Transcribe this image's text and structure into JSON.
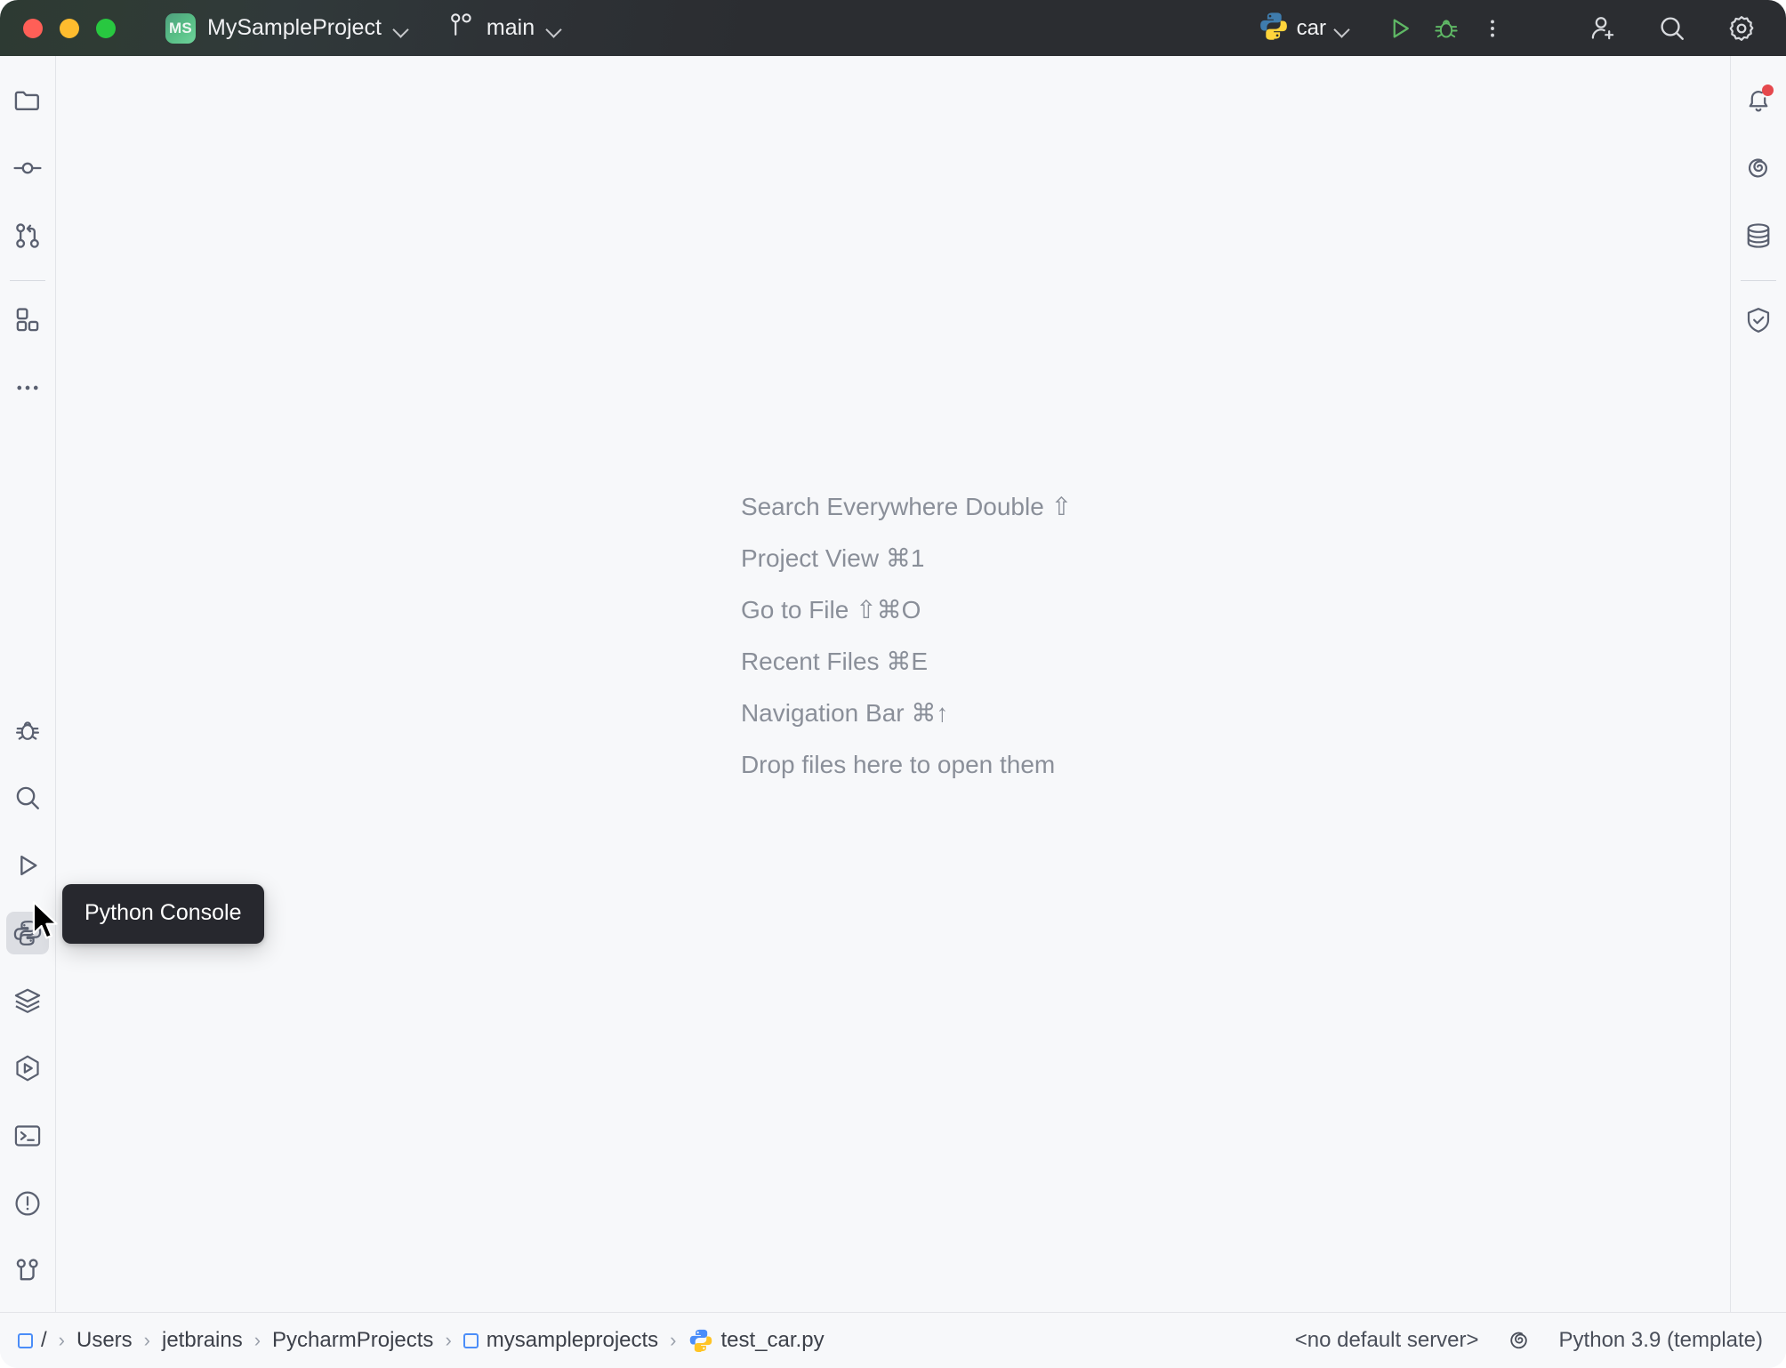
{
  "window": {
    "traffic_lights": [
      "close",
      "minimize",
      "maximize"
    ],
    "colors": {
      "close": "#ff5f57",
      "minimize": "#febc2e",
      "maximize": "#28c840",
      "accent_green": "#59a869",
      "notification_dot": "#e5484d",
      "python_blue": "#3f7cad",
      "python_yellow": "#ffd43b",
      "titlebar_bg": "#2b2d31",
      "app_bg": "#f7f8fa",
      "tooltip_bg": "#27282e"
    }
  },
  "titlebar": {
    "project_badge": "MS",
    "project_name": "MySampleProject",
    "project_chevron_icon": "chevron-down-icon",
    "vcs_branch_icon": "branch-icon",
    "branch_name": "main",
    "branch_chevron_icon": "chevron-down-icon",
    "run_config_icon": "python-icon",
    "run_config_name": "car",
    "run_config_chevron_icon": "chevron-down-icon",
    "run_button": "run-icon",
    "debug_button": "debug-icon",
    "more_button": "more-vertical-icon",
    "code_with_me": "add-user-icon",
    "search_button": "search-icon",
    "settings_button": "gear-icon"
  },
  "left_sidebar": {
    "top_items": [
      {
        "name": "project-tool-window",
        "icon": "folder-icon",
        "active": false
      },
      {
        "name": "commit-tool-window",
        "icon": "commit-icon",
        "active": false
      },
      {
        "name": "pull-requests-tool-window",
        "icon": "pull-request-icon",
        "active": false
      }
    ],
    "after_separator": [
      {
        "name": "structure-tool-window",
        "icon": "structure-icon",
        "active": false
      },
      {
        "name": "more-tool-windows",
        "icon": "more-horizontal-icon",
        "active": false
      }
    ],
    "bottom_items": [
      {
        "name": "debug-tool-window",
        "icon": "debug-bug-icon",
        "active": false
      },
      {
        "name": "find-tool-window",
        "icon": "search-icon",
        "active": false
      },
      {
        "name": "run-tool-window",
        "icon": "run-triangle-icon",
        "active": false
      },
      {
        "name": "python-console-tool-window",
        "icon": "python-icon",
        "active": true
      },
      {
        "name": "services-tool-window",
        "icon": "layers-icon",
        "active": false
      },
      {
        "name": "python-packages-tool-window",
        "icon": "hex-run-icon",
        "active": false
      },
      {
        "name": "terminal-tool-window",
        "icon": "terminal-icon",
        "active": false
      },
      {
        "name": "problems-tool-window",
        "icon": "warning-circle-icon",
        "active": false
      },
      {
        "name": "version-control-tool-window",
        "icon": "branch-icon",
        "active": false
      }
    ]
  },
  "right_sidebar": {
    "items": [
      {
        "name": "notifications-tool-window",
        "icon": "bell-icon",
        "badge": true
      },
      {
        "name": "ai-assistant-tool-window",
        "icon": "spiral-icon",
        "badge": false
      },
      {
        "name": "database-tool-window",
        "icon": "database-icon",
        "badge": false
      }
    ],
    "after_separator": [
      {
        "name": "security-tool-window",
        "icon": "shield-check-icon",
        "badge": false
      }
    ]
  },
  "editor": {
    "hints": [
      {
        "label": "Search Everywhere",
        "shortcut": "Double ⇧"
      },
      {
        "label": "Project View",
        "shortcut": "⌘1"
      },
      {
        "label": "Go to File",
        "shortcut": "⇧⌘O"
      },
      {
        "label": "Recent Files",
        "shortcut": "⌘E"
      },
      {
        "label": "Navigation Bar",
        "shortcut": "⌘↑"
      },
      {
        "label": "Drop files here to open them",
        "shortcut": ""
      }
    ]
  },
  "tooltip": {
    "visible": true,
    "text": "Python Console"
  },
  "statusbar": {
    "breadcrumbs": [
      {
        "label": "/",
        "icon": "folder-mini-icon"
      },
      {
        "label": "Users",
        "icon": ""
      },
      {
        "label": "jetbrains",
        "icon": ""
      },
      {
        "label": "PycharmProjects",
        "icon": ""
      },
      {
        "label": "mysampleprojects",
        "icon": "folder-mini-icon"
      },
      {
        "label": "test_car.py",
        "icon": "python-icon"
      }
    ],
    "separator": "›",
    "server": "<no default server>",
    "ai_icon": "spiral-icon",
    "interpreter": "Python 3.9 (template)"
  }
}
